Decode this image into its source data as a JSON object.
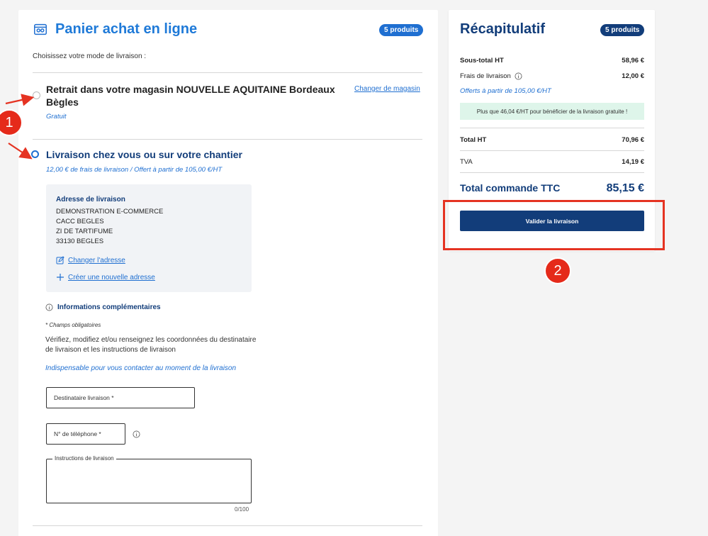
{
  "main": {
    "title": "Panier achat en ligne",
    "badge": "5 produits",
    "choose_label": "Choisissez votre mode de livraison :",
    "option_store": {
      "title_line1": "Retrait dans votre magasin NOUVELLE AQUITAINE Bordeaux",
      "title_line2": "Bègles",
      "subtitle": "Gratuit",
      "change_link": "Changer de magasin",
      "selected": false
    },
    "option_home": {
      "title": "Livraison chez vous ou sur votre chantier",
      "subtitle": "12,00 € de frais de livraison / Offert à partir de 105,00 €/HT",
      "selected": true
    },
    "address": {
      "title": "Adresse de livraison",
      "lines": [
        "DEMONSTRATION E-COMMERCE",
        "CACC BEGLES",
        "ZI DE TARTIFUME",
        "33130 BEGLES"
      ],
      "change_label": "Changer l'adresse",
      "new_label": "Créer une nouvelle adresse"
    },
    "info": {
      "title": "Informations complémentaires",
      "required_note": "* Champs obligatoires",
      "description": "Vérifiez, modifiez et/ou renseignez les coordonnées du destinataire de livraison et les instructions de livraison",
      "contact_note": "Indispensable pour vous contacter au moment de la livraison"
    },
    "form": {
      "recipient_placeholder": "Destinataire livraison *",
      "phone_placeholder": "N° de téléphone *",
      "instructions_label": "Instructions de livraison",
      "counter": "0/100"
    }
  },
  "summary": {
    "title": "Récapitulatif",
    "badge": "5 produits",
    "subtotal_label": "Sous-total HT",
    "subtotal_value": "58,96 €",
    "shipping_label": "Frais de livraison",
    "shipping_value": "12,00 €",
    "offer_note": "Offerts à partir de 105,00 €/HT",
    "promo": "Plus que 46,04 €/HT pour bénéficier de la livraison gratuite !",
    "total_ht_label": "Total HT",
    "total_ht_value": "70,96 €",
    "tva_label": "TVA",
    "tva_value": "14,19 €",
    "total_ttc_label": "Total commande TTC",
    "total_ttc_value": "85,15 €",
    "validate_label": "Valider la livraison"
  },
  "annotations": {
    "marker_1": "1",
    "marker_2": "2"
  },
  "colors": {
    "brand_blue": "#1f7ad8",
    "navy": "#123d7a",
    "annotation_red": "#e53322",
    "promo_bg": "#def5ea"
  }
}
